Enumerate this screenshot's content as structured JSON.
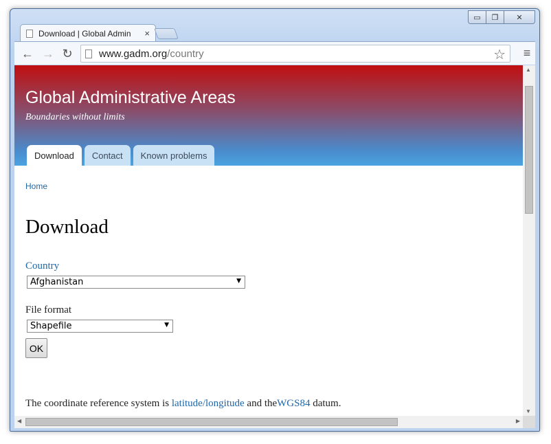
{
  "browser": {
    "tab_title": "Download | Global Admin",
    "tab_close": "×",
    "url_host": "www.gadm.org",
    "url_path": "/country",
    "back": "←",
    "forward": "→",
    "reload": "↻",
    "star": "☆",
    "menu": "≡",
    "win_minimize": "▭",
    "win_maximize": "❐",
    "win_close": "✕"
  },
  "site": {
    "name": "Global Administrative Areas",
    "slogan": "Boundaries without limits",
    "tabs": [
      {
        "label": "Download",
        "active": true
      },
      {
        "label": "Contact",
        "active": false
      },
      {
        "label": "Known problems",
        "active": false
      }
    ]
  },
  "page": {
    "breadcrumb": "Home",
    "title": "Download",
    "country_label": "Country",
    "country_value": "Afghanistan",
    "format_label": "File format",
    "format_value": "Shapefile",
    "ok_label": "OK",
    "crs_prefix": "The coordinate reference system is ",
    "crs_link": "latitude/longitude",
    "crs_middle": " and the",
    "datum_link": "WGS84",
    "crs_suffix": " datum."
  },
  "colors": {
    "header_top": "#c00f10",
    "header_bottom": "#4aa3e0",
    "link": "#1f67a8"
  },
  "icons": {
    "select_arrow": "▼",
    "scroll_up": "▲",
    "scroll_down": "▼",
    "scroll_left": "◀",
    "scroll_right": "▶"
  }
}
